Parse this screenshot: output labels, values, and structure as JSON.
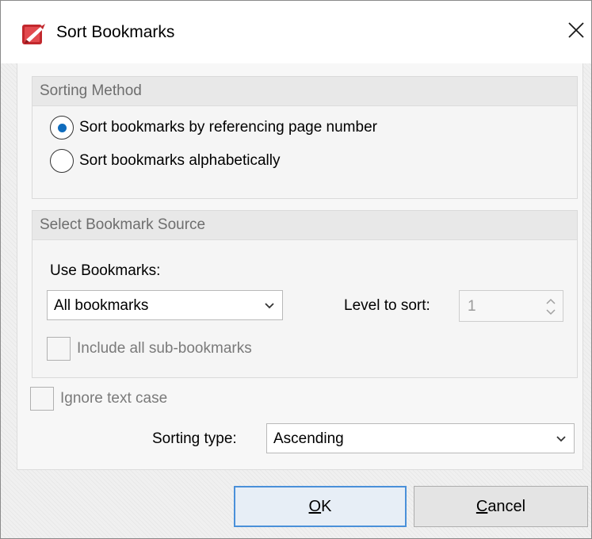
{
  "window": {
    "title": "Sort Bookmarks",
    "close_symbol": "✕",
    "app_icon": "pdf-app-icon",
    "accent_color": "#0f6cbd",
    "brand_color": "#c2282d"
  },
  "sorting_method": {
    "heading": "Sorting Method",
    "options": [
      {
        "label": "Sort bookmarks by referencing page number",
        "selected": true
      },
      {
        "label": "Sort bookmarks alphabetically",
        "selected": false
      }
    ]
  },
  "bookmark_source": {
    "heading": "Select Bookmark Source",
    "use_label": "Use Bookmarks:",
    "use_value": "All bookmarks",
    "level_label": "Level to sort:",
    "level_value": "1",
    "include_sub_label": "Include all sub-bookmarks",
    "include_sub_checked": false
  },
  "ignore_case": {
    "label": "Ignore text case",
    "checked": false
  },
  "sorting_type": {
    "label": "Sorting type:",
    "value": "Ascending"
  },
  "buttons": {
    "ok_mnemonic": "O",
    "ok_rest": "K",
    "cancel_mnemonic": "C",
    "cancel_rest": "ancel"
  }
}
